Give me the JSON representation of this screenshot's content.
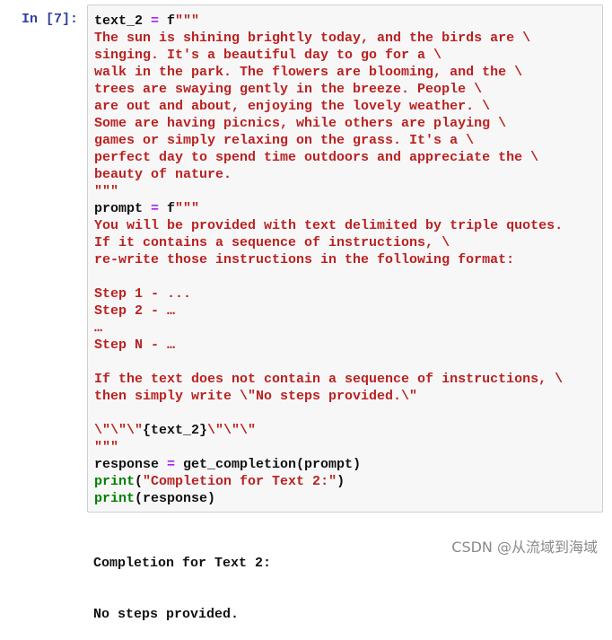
{
  "cell": {
    "prompt_label": "In [7]:",
    "token_colors": {
      "string": "#ba2121",
      "operator": "#aa22ff",
      "builtin": "#008000",
      "default": "#111111"
    },
    "lines": [
      [
        [
          "text_2 ",
          "n"
        ],
        [
          "=",
          "o"
        ],
        [
          " f",
          "n"
        ],
        [
          "\"\"\"",
          "s"
        ]
      ],
      [
        [
          "The sun is shining brightly today, and the birds are \\",
          "s"
        ]
      ],
      [
        [
          "singing. It's a beautiful day to go for a \\",
          "s"
        ]
      ],
      [
        [
          "walk in the park. The flowers are blooming, and the \\",
          "s"
        ]
      ],
      [
        [
          "trees are swaying gently in the breeze. People \\",
          "s"
        ]
      ],
      [
        [
          "are out and about, enjoying the lovely weather. \\",
          "s"
        ]
      ],
      [
        [
          "Some are having picnics, while others are playing \\",
          "s"
        ]
      ],
      [
        [
          "games or simply relaxing on the grass. It's a \\",
          "s"
        ]
      ],
      [
        [
          "perfect day to spend time outdoors and appreciate the \\",
          "s"
        ]
      ],
      [
        [
          "beauty of nature.",
          "s"
        ]
      ],
      [
        [
          "\"\"\"",
          "s"
        ]
      ],
      [
        [
          "prompt ",
          "n"
        ],
        [
          "=",
          "o"
        ],
        [
          " f",
          "n"
        ],
        [
          "\"\"\"",
          "s"
        ]
      ],
      [
        [
          "You will be provided with text delimited by triple quotes.",
          "s"
        ]
      ],
      [
        [
          "If it contains a sequence of instructions, \\",
          "s"
        ]
      ],
      [
        [
          "re-write those instructions in the following format:",
          "s"
        ]
      ],
      [
        [
          "",
          "s"
        ]
      ],
      [
        [
          "Step 1 - ...",
          "s"
        ]
      ],
      [
        [
          "Step 2 - …",
          "s"
        ]
      ],
      [
        [
          "…",
          "s"
        ]
      ],
      [
        [
          "Step N - …",
          "s"
        ]
      ],
      [
        [
          "",
          "s"
        ]
      ],
      [
        [
          "If the text does not contain a sequence of instructions, \\",
          "s"
        ]
      ],
      [
        [
          "then simply write \\\"No steps provided.\\\"",
          "s"
        ]
      ],
      [
        [
          "",
          "s"
        ]
      ],
      [
        [
          "\\\"\\\"\\\"",
          "s"
        ],
        [
          "{text_2}",
          "n"
        ],
        [
          "\\\"\\\"\\\"",
          "s"
        ]
      ],
      [
        [
          "\"\"\"",
          "s"
        ]
      ],
      [
        [
          "response ",
          "n"
        ],
        [
          "=",
          "o"
        ],
        [
          " get_completion(prompt)",
          "n"
        ]
      ],
      [
        [
          "print",
          "b"
        ],
        [
          "(",
          "n"
        ],
        [
          "\"Completion for Text 2:\"",
          "s"
        ],
        [
          ")",
          "n"
        ]
      ],
      [
        [
          "print",
          "b"
        ],
        [
          "(response)",
          "n"
        ]
      ]
    ]
  },
  "output": {
    "lines": [
      "Completion for Text 2:",
      "No steps provided."
    ]
  },
  "watermark": "CSDN @从流域到海域"
}
